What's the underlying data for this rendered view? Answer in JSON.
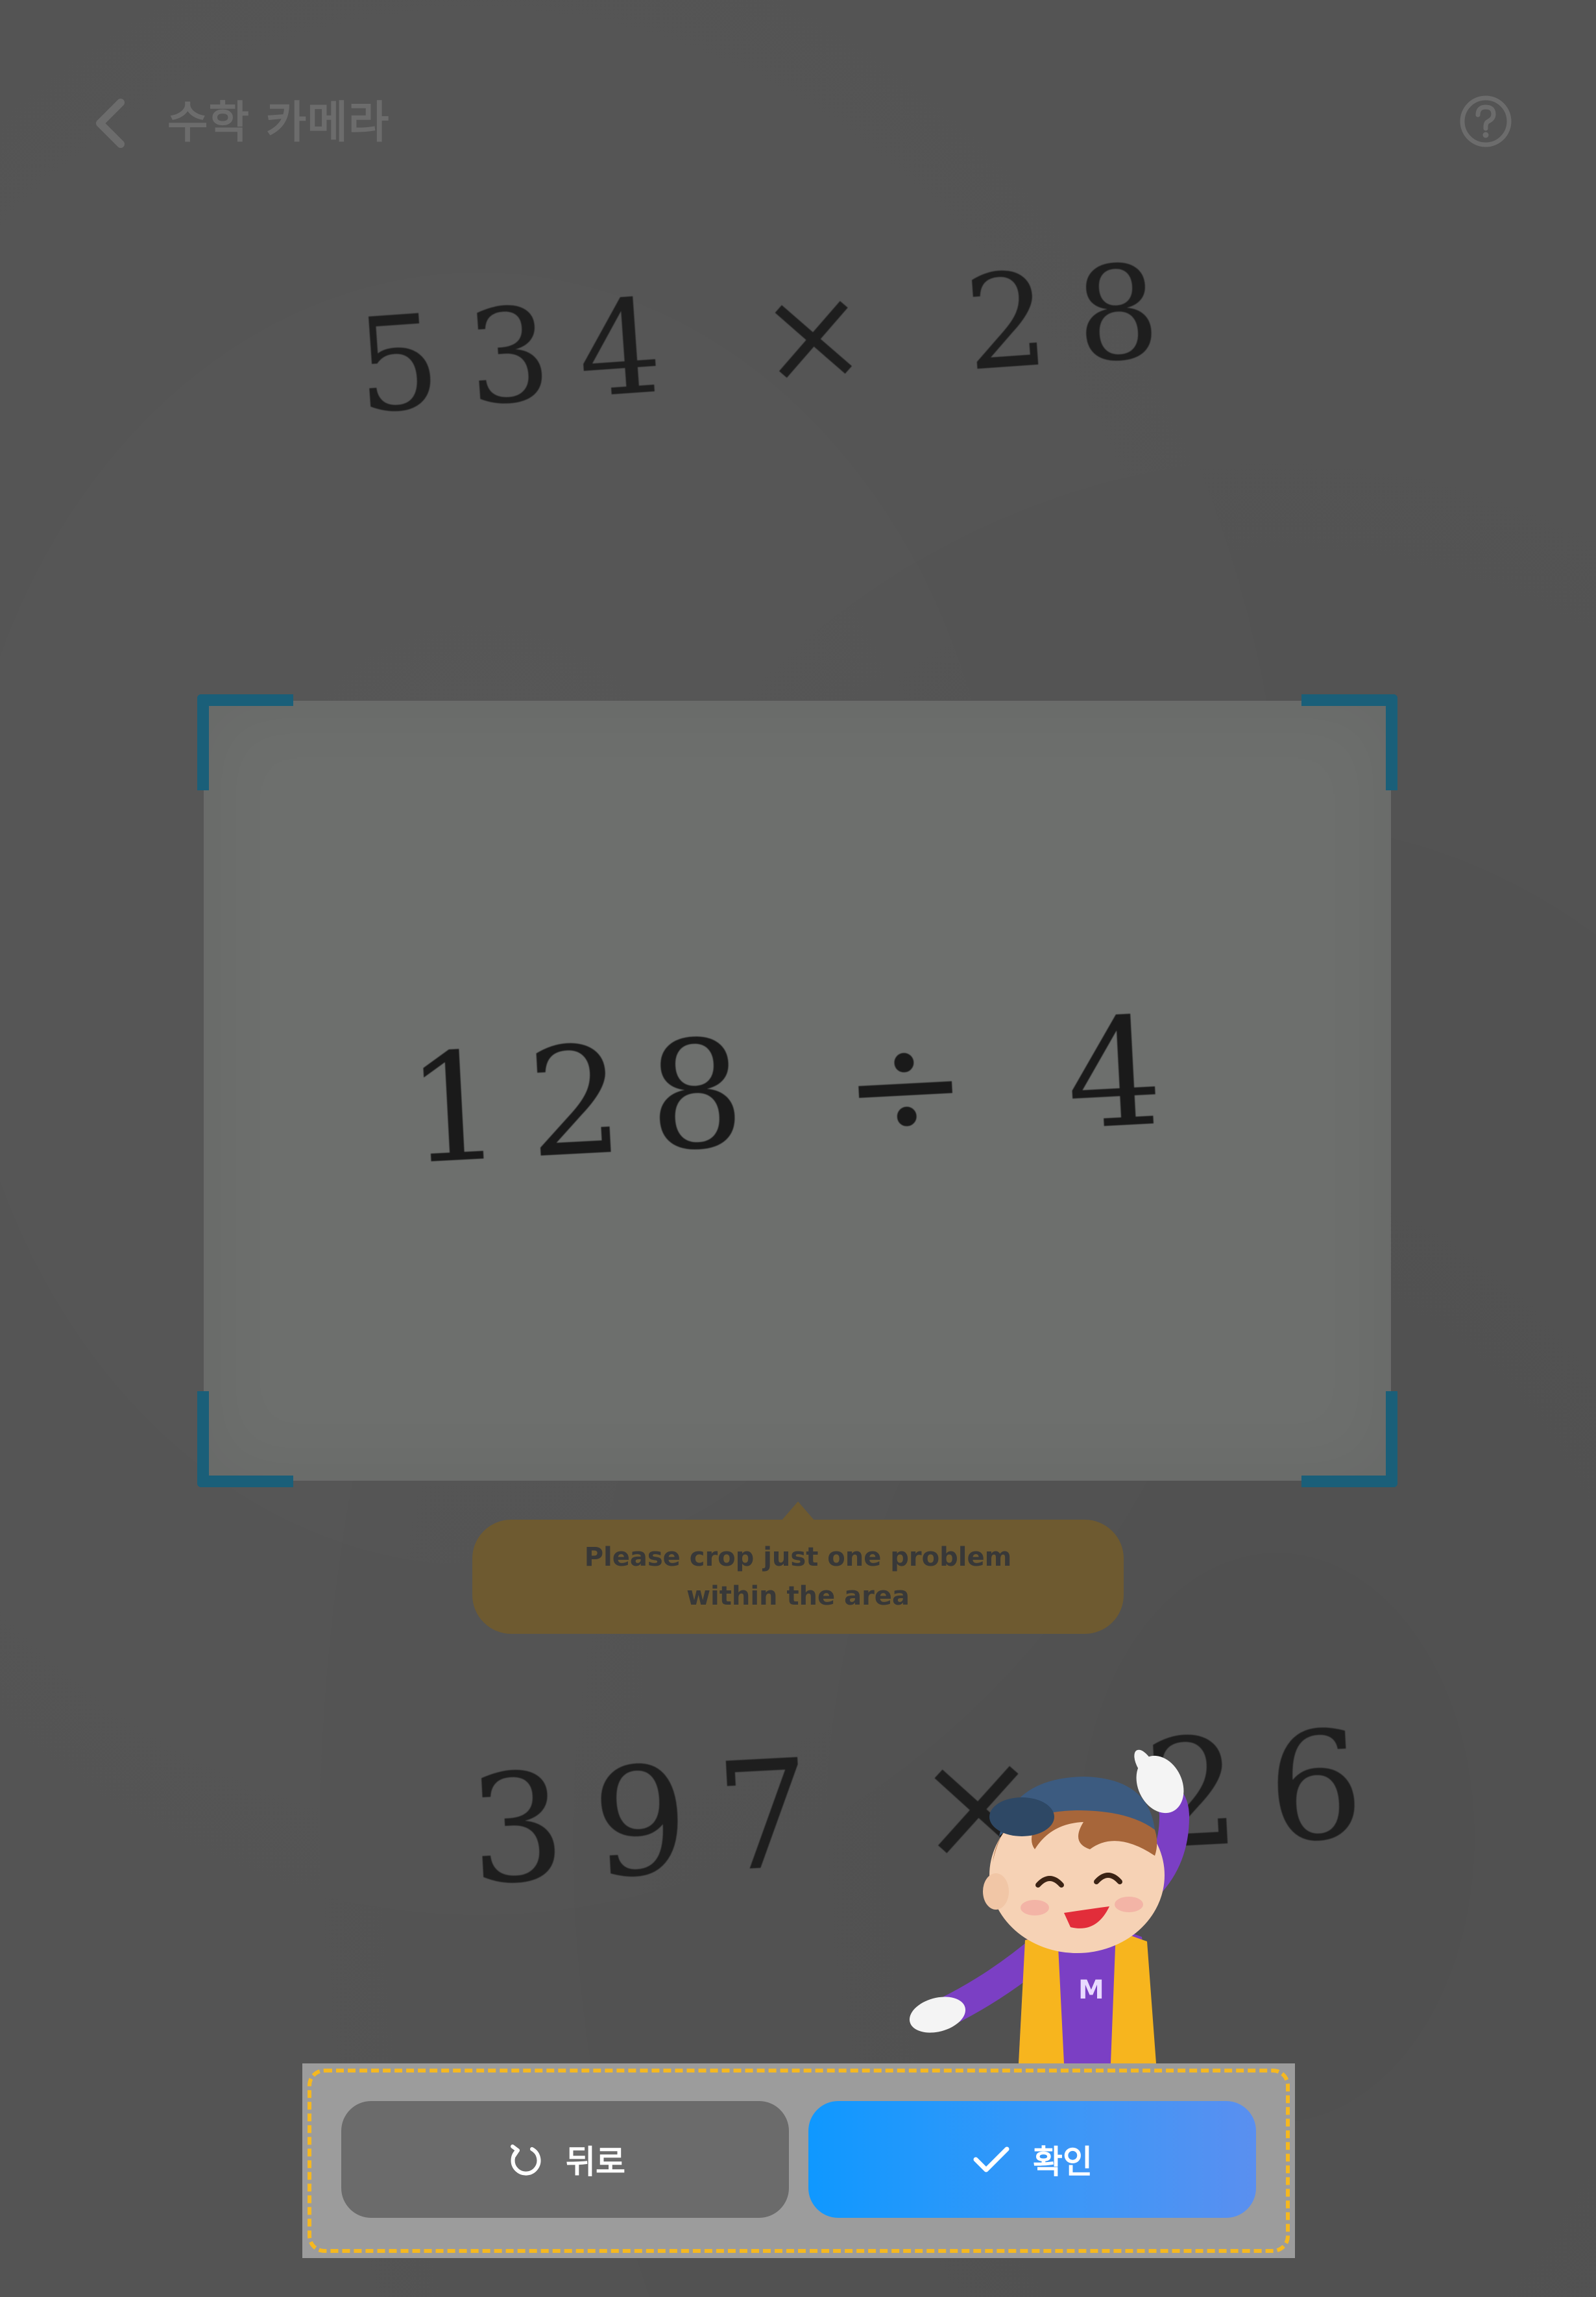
{
  "header": {
    "title": "수학 카메라",
    "back_icon": "chevron-left-icon",
    "help_icon": "help-circle-icon"
  },
  "problems": {
    "above": "534 × 28",
    "selected": "128 ÷ 4",
    "below": "397 × 26"
  },
  "tooltip": {
    "line1": "Please crop just one problem",
    "line2": "within the area"
  },
  "actions": {
    "back_label": "뒤로",
    "back_icon": "rotate-ccw-icon",
    "confirm_label": "확인",
    "confirm_icon": "check-icon"
  },
  "colors": {
    "background": "#545454",
    "crop_area": "#6d6f6d",
    "crop_corner": "#1a5f79",
    "tooltip": "#6e5a30",
    "confirm_button": "#0f98ff",
    "back_button": "#6b6b6b",
    "highlight_outline": "#f5b820"
  }
}
